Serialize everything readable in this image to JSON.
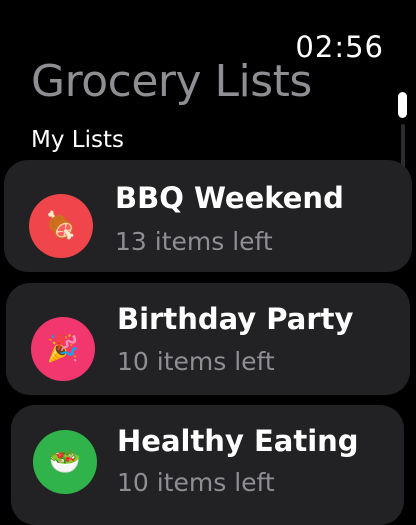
{
  "status": {
    "time": "02:56"
  },
  "header": {
    "title": "Grocery Lists",
    "section_title": "My Lists"
  },
  "lists": [
    {
      "name": "BBQ Weekend",
      "subtitle": "13 items left",
      "icon": "meat-on-bone-icon",
      "glyph": "🍖",
      "color": "#f0454b"
    },
    {
      "name": "Birthday Party",
      "subtitle": "10 items left",
      "icon": "party-popper-icon",
      "glyph": "🎉",
      "color": "#f2376f"
    },
    {
      "name": "Healthy Eating",
      "subtitle": "10 items left",
      "icon": "salad-icon",
      "glyph": "🥗",
      "color": "#2fb34a"
    }
  ]
}
